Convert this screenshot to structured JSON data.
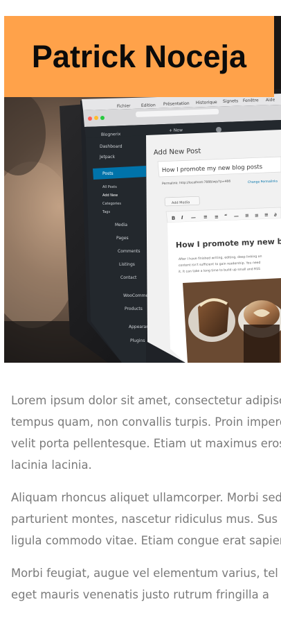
{
  "header": {
    "title": "Patrick Noceja"
  },
  "hero_image": {
    "screen": {
      "menu_items": [
        "Fichier",
        "Edition",
        "Présentation",
        "Historique",
        "Signets",
        "Fenêtre",
        "Aide"
      ],
      "admin_bar_new": "+ New",
      "admin_bar_site": "Blognerix",
      "sidebar_items": [
        "Dashboard",
        "Jetpack",
        "Posts",
        "All Posts",
        "Add New",
        "Categories",
        "Tags",
        "Media",
        "Pages",
        "Comments",
        "Listings",
        "Contact",
        "WooCommerce",
        "Products",
        "Appearance",
        "Plugins"
      ],
      "page_heading": "Add New Post",
      "post_title": "How I promote my new blog posts",
      "permalink": "Permalink: http://localhost:7888/wp/?p=466",
      "change_permalinks": "Change Permalinks",
      "add_media": "Add Media",
      "content_heading": "How I promote my new blo",
      "content_body_1": "After I have finished writing, editing, deep linking an",
      "content_body_2": "content isn't sufficient to gain readership. You need",
      "content_body_3": "it. It can take a long time to build up small and RSS"
    }
  },
  "article": {
    "paragraphs": [
      {
        "lines": [
          "Lorem ipsum dolor sit amet, consectetur adipiscing",
          "tempus quam, non convallis turpis. Proin imperdiet",
          "velit porta pellentesque. Etiam ut maximus eros",
          "lacinia lacinia."
        ]
      },
      {
        "lines": [
          "Aliquam rhoncus aliquet ullamcorper. Morbi sed",
          "parturient montes, nascetur ridiculus mus. Sus",
          "ligula commodo vitae. Etiam congue erat sapien"
        ]
      },
      {
        "lines": [
          "Morbi feugiat, augue vel elementum varius, tel",
          "eget mauris venenatis justo rutrum fringilla a"
        ]
      }
    ]
  },
  "colors": {
    "title_background": "#ffa24a",
    "title_text": "#0b0b0b",
    "body_text": "#7a7a7a",
    "page_background": "#ffffff"
  }
}
